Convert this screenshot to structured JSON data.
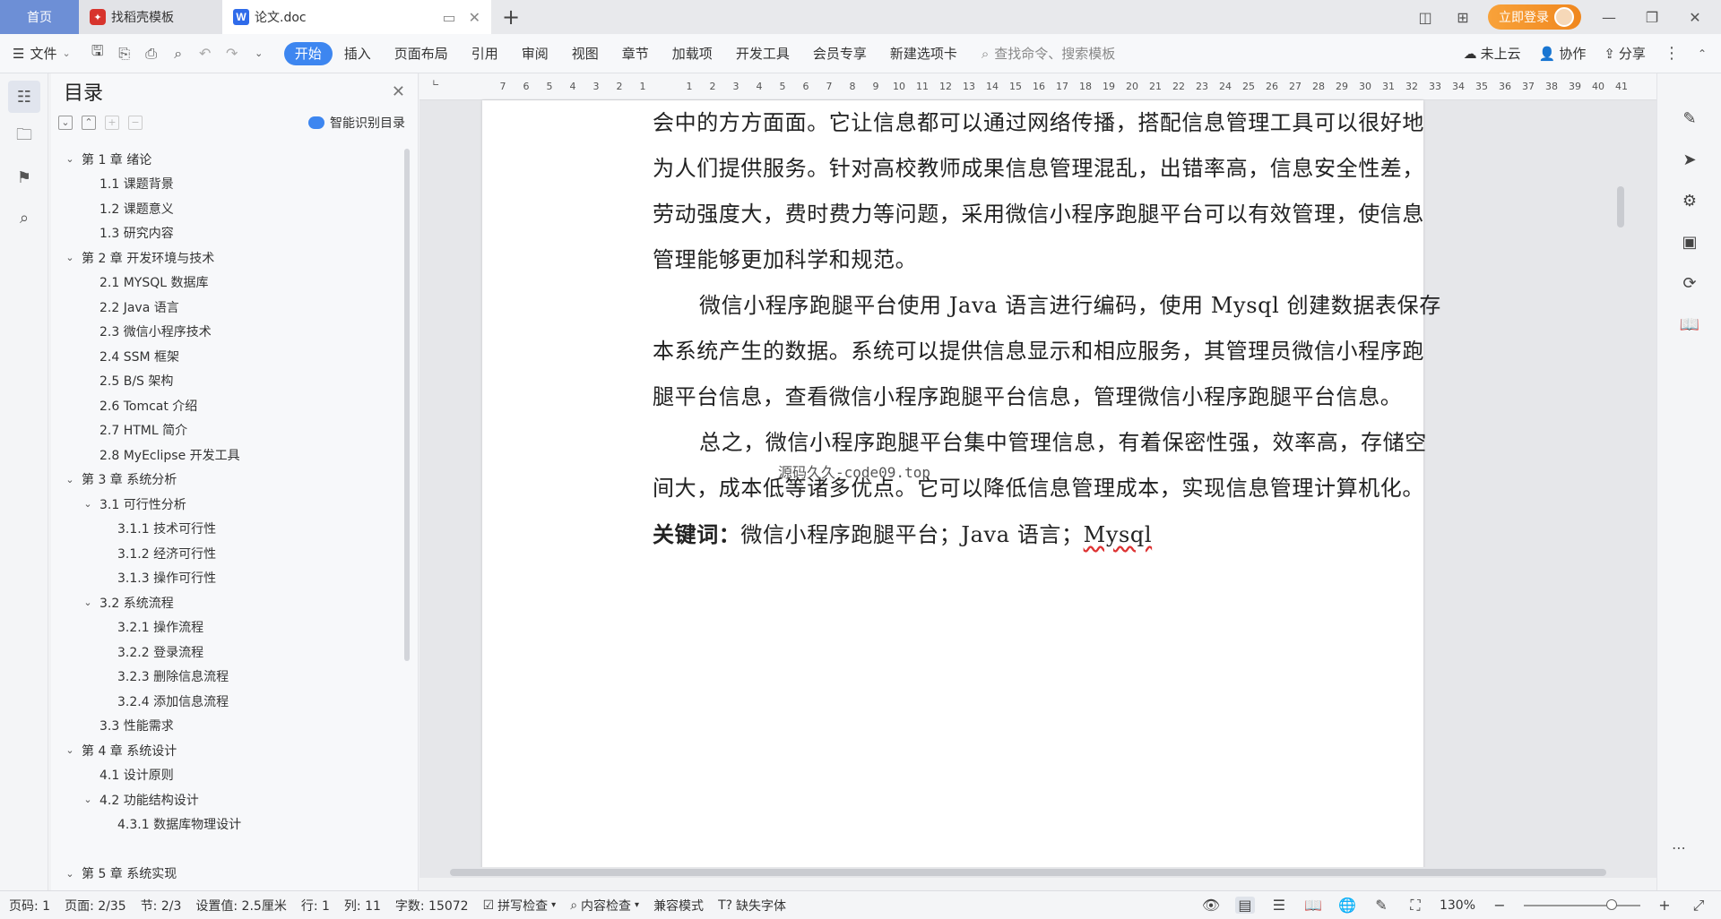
{
  "titlebar": {
    "home_tab": "首页",
    "template_tab": "找稻壳模板",
    "doc_tab": "论文.doc",
    "login_label": "立即登录"
  },
  "menubar": {
    "file_label": "文件",
    "items": [
      "开始",
      "插入",
      "页面布局",
      "引用",
      "审阅",
      "视图",
      "章节",
      "加载项",
      "开发工具",
      "会员专享",
      "新建选项卡"
    ],
    "search_placeholder": "查找命令、搜索模板",
    "cloud_label": "未上云",
    "collab_label": "协作",
    "share_label": "分享"
  },
  "toc": {
    "title": "目录",
    "smart_label": "智能识别目录",
    "items": [
      {
        "level": 1,
        "chev": "expanded",
        "text": "第 1 章  绪论"
      },
      {
        "level": 2,
        "chev": "none",
        "text": "1.1  课题背景"
      },
      {
        "level": 2,
        "chev": "none",
        "text": "1.2  课题意义"
      },
      {
        "level": 2,
        "chev": "none",
        "text": "1.3  研究内容"
      },
      {
        "level": 1,
        "chev": "expanded",
        "text": "第 2 章  开发环境与技术"
      },
      {
        "level": 2,
        "chev": "none",
        "text": "2.1  MYSQL 数据库"
      },
      {
        "level": 2,
        "chev": "none",
        "text": "2.2 Java 语言"
      },
      {
        "level": 2,
        "chev": "none",
        "text": "2.3  微信小程序技术"
      },
      {
        "level": 2,
        "chev": "none",
        "text": "2.4 SSM 框架"
      },
      {
        "level": 2,
        "chev": "none",
        "text": "2.5 B/S 架构"
      },
      {
        "level": 2,
        "chev": "none",
        "text": "2.6 Tomcat  介绍"
      },
      {
        "level": 2,
        "chev": "none",
        "text": "2.7 HTML 简介"
      },
      {
        "level": 2,
        "chev": "none",
        "text": "2.8 MyEclipse 开发工具"
      },
      {
        "level": 1,
        "chev": "expanded",
        "text": "第 3 章  系统分析"
      },
      {
        "level": 2,
        "chev": "expanded",
        "text": "3.1  可行性分析"
      },
      {
        "level": 3,
        "chev": "none",
        "text": "3.1.1  技术可行性"
      },
      {
        "level": 3,
        "chev": "none",
        "text": "3.1.2  经济可行性"
      },
      {
        "level": 3,
        "chev": "none",
        "text": "3.1.3  操作可行性"
      },
      {
        "level": 2,
        "chev": "expanded",
        "text": "3.2  系统流程"
      },
      {
        "level": 3,
        "chev": "none",
        "text": "3.2.1  操作流程"
      },
      {
        "level": 3,
        "chev": "none",
        "text": "3.2.2  登录流程"
      },
      {
        "level": 3,
        "chev": "none",
        "text": "3.2.3  删除信息流程"
      },
      {
        "level": 3,
        "chev": "none",
        "text": "3.2.4  添加信息流程"
      },
      {
        "level": 2,
        "chev": "none",
        "text": "3.3  性能需求"
      },
      {
        "level": 1,
        "chev": "expanded",
        "text": "第 4 章  系统设计"
      },
      {
        "level": 2,
        "chev": "none",
        "text": "4.1  设计原则"
      },
      {
        "level": 2,
        "chev": "expanded",
        "text": "4.2  功能结构设计"
      },
      {
        "level": 3,
        "chev": "none",
        "text": "4.3.1  数据库物理设计"
      },
      {
        "level": 1,
        "chev": "blank",
        "text": ""
      },
      {
        "level": 1,
        "chev": "expanded",
        "text": "第 5 章  系统实现"
      }
    ]
  },
  "ruler": {
    "ticks": [
      "7",
      "6",
      "5",
      "4",
      "3",
      "2",
      "1",
      "",
      "1",
      "2",
      "3",
      "4",
      "5",
      "6",
      "7",
      "8",
      "9",
      "10",
      "11",
      "12",
      "13",
      "14",
      "15",
      "16",
      "17",
      "18",
      "19",
      "20",
      "21",
      "22",
      "23",
      "24",
      "25",
      "26",
      "27",
      "28",
      "29",
      "30",
      "31",
      "32",
      "33",
      "34",
      "35",
      "36",
      "37",
      "38",
      "39",
      "40",
      "41"
    ]
  },
  "document": {
    "lines": [
      {
        "text": "会中的方方面面。它让信息都可以通过网络传播，搭配信息管理工具可以很好地",
        "indent": false
      },
      {
        "text": "为人们提供服务。针对高校教师成果信息管理混乱，出错率高，信息安全性差，",
        "indent": false
      },
      {
        "text": "劳动强度大，费时费力等问题，采用微信小程序跑腿平台可以有效管理，使信息",
        "indent": false
      },
      {
        "text": "管理能够更加科学和规范。",
        "indent": false
      },
      {
        "text": "微信小程序跑腿平台使用 Java 语言进行编码，使用 Mysql 创建数据表保存",
        "indent": true
      },
      {
        "text": "本系统产生的数据。系统可以提供信息显示和相应服务，其管理员微信小程序跑",
        "indent": false
      },
      {
        "text": "腿平台信息，查看微信小程序跑腿平台信息，管理微信小程序跑腿平台信息。",
        "indent": false
      },
      {
        "text": "总之，微信小程序跑腿平台集中管理信息，有着保密性强，效率高，存储空",
        "indent": true
      },
      {
        "text": "间大，成本低等诸多优点。它可以降低信息管理成本，实现信息管理计算机化。",
        "indent": false
      }
    ],
    "keywords_label": "关键词：",
    "keywords_text": "微信小程序跑腿平台；Java 语言；",
    "keywords_mysql": "Mysql",
    "watermark": "源码久久-code09.top"
  },
  "statusbar": {
    "page_code": "页码: 1",
    "page": "页面: 2/35",
    "section": "节: 2/3",
    "setting": "设置值: 2.5厘米",
    "row": "行: 1",
    "col": "列: 11",
    "word_count": "字数: 15072",
    "spell_check": "拼写检查",
    "content_check": "内容检查",
    "compat_mode": "兼容模式",
    "missing_font": "缺失字体",
    "zoom": "130%"
  }
}
